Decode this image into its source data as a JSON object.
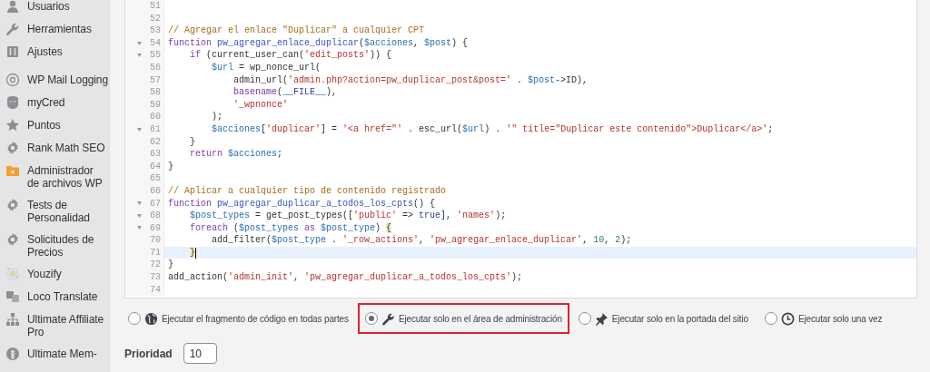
{
  "sidebar": {
    "groups": [
      {
        "items": [
          {
            "label": "Usuarios"
          },
          {
            "label": "Herramientas"
          },
          {
            "label": "Ajustes"
          }
        ]
      },
      {
        "items": [
          {
            "label": "WP Mail Logging"
          },
          {
            "label": "myCred"
          },
          {
            "label": "Puntos"
          },
          {
            "label": "Rank Math SEO"
          },
          {
            "label": "Administrador de archivos WP"
          },
          {
            "label": "Tests de Personalidad"
          },
          {
            "label": "Solicitudes de Precios"
          },
          {
            "label": "Youzify"
          },
          {
            "label": "Loco Translate"
          },
          {
            "label": "Ultimate Affiliate Pro"
          },
          {
            "label": "Ultimate Mem-"
          }
        ]
      }
    ]
  },
  "editor": {
    "lines": [
      {
        "number": "51",
        "foldable": false,
        "active": false
      },
      {
        "number": "52",
        "foldable": false,
        "active": false
      },
      {
        "number": "53",
        "foldable": false,
        "active": false,
        "tokens": [
          {
            "text": "// Agregar el enlace \"Duplicar\" a cualquier CPT",
            "kind": "comment"
          }
        ]
      },
      {
        "number": "54",
        "foldable": true,
        "active": false,
        "tokens": [
          {
            "text": "function ",
            "kind": "keyword"
          },
          {
            "text": "pw_agregar_enlace_duplicar",
            "kind": "def"
          },
          {
            "text": "(",
            "kind": "plain"
          },
          {
            "text": "$acciones",
            "kind": "variable"
          },
          {
            "text": ", ",
            "kind": "plain"
          },
          {
            "text": "$post",
            "kind": "variable"
          },
          {
            "text": ") {",
            "kind": "plain"
          }
        ]
      },
      {
        "number": "55",
        "foldable": true,
        "active": false,
        "tokens": [
          {
            "text": "    if",
            "kind": "keyword"
          },
          {
            "text": " (current_user_can(",
            "kind": "plain"
          },
          {
            "text": "'edit_posts'",
            "kind": "string"
          },
          {
            "text": ")) {",
            "kind": "plain"
          }
        ]
      },
      {
        "number": "56",
        "foldable": false,
        "active": false,
        "tokens": [
          {
            "text": "        $url",
            "kind": "variable"
          },
          {
            "text": " = wp_nonce_url(",
            "kind": "plain"
          }
        ]
      },
      {
        "number": "57",
        "foldable": false,
        "active": false,
        "tokens": [
          {
            "text": "            admin_url(",
            "kind": "plain"
          },
          {
            "text": "'admin.php?action=pw_duplicar_post&post='",
            "kind": "string"
          },
          {
            "text": " . ",
            "kind": "plain"
          },
          {
            "text": "$post",
            "kind": "variable"
          },
          {
            "text": "->ID),",
            "kind": "plain"
          }
        ]
      },
      {
        "number": "58",
        "foldable": false,
        "active": false,
        "tokens": [
          {
            "text": "            basename",
            "kind": "builtin"
          },
          {
            "text": "(",
            "kind": "plain"
          },
          {
            "text": "__FILE__",
            "kind": "atom"
          },
          {
            "text": "),",
            "kind": "plain"
          }
        ]
      },
      {
        "number": "59",
        "foldable": false,
        "active": false,
        "tokens": [
          {
            "text": "            '_wpnonce'",
            "kind": "string"
          }
        ]
      },
      {
        "number": "60",
        "foldable": false,
        "active": false,
        "tokens": [
          {
            "text": "        );",
            "kind": "plain"
          }
        ]
      },
      {
        "number": "61",
        "foldable": true,
        "active": false,
        "tokens": [
          {
            "text": "        $acciones",
            "kind": "variable"
          },
          {
            "text": "[",
            "kind": "plain"
          },
          {
            "text": "'duplicar'",
            "kind": "string"
          },
          {
            "text": "] = ",
            "kind": "plain"
          },
          {
            "text": "'<a href=\"'",
            "kind": "string"
          },
          {
            "text": " . esc_url(",
            "kind": "plain"
          },
          {
            "text": "$url",
            "kind": "variable"
          },
          {
            "text": ") . ",
            "kind": "plain"
          },
          {
            "text": "'\" title=\"Duplicar este contenido\">Duplicar</a>'",
            "kind": "string"
          },
          {
            "text": ";",
            "kind": "plain"
          }
        ]
      },
      {
        "number": "62",
        "foldable": false,
        "active": false,
        "tokens": [
          {
            "text": "    }",
            "kind": "plain"
          }
        ]
      },
      {
        "number": "63",
        "foldable": false,
        "active": false,
        "tokens": [
          {
            "text": "    return ",
            "kind": "keyword"
          },
          {
            "text": "$acciones",
            "kind": "variable"
          },
          {
            "text": ";",
            "kind": "plain"
          }
        ]
      },
      {
        "number": "64",
        "foldable": false,
        "active": false,
        "tokens": [
          {
            "text": "}",
            "kind": "plain"
          }
        ]
      },
      {
        "number": "65",
        "foldable": false,
        "active": false
      },
      {
        "number": "66",
        "foldable": false,
        "active": false,
        "tokens": [
          {
            "text": "// Aplicar a cualquier tipo de contenido registrado",
            "kind": "comment"
          }
        ]
      },
      {
        "number": "67",
        "foldable": true,
        "active": false,
        "tokens": [
          {
            "text": "function ",
            "kind": "keyword"
          },
          {
            "text": "pw_agregar_duplicar_a_todos_los_cpts",
            "kind": "def"
          },
          {
            "text": "() {",
            "kind": "plain"
          }
        ]
      },
      {
        "number": "68",
        "foldable": true,
        "active": false,
        "tokens": [
          {
            "text": "    $post_types",
            "kind": "variable"
          },
          {
            "text": " = get_post_types([",
            "kind": "plain"
          },
          {
            "text": "'public'",
            "kind": "string"
          },
          {
            "text": " => ",
            "kind": "plain"
          },
          {
            "text": "true",
            "kind": "atom"
          },
          {
            "text": "], ",
            "kind": "plain"
          },
          {
            "text": "'names'",
            "kind": "string"
          },
          {
            "text": ");",
            "kind": "plain"
          }
        ]
      },
      {
        "number": "69",
        "foldable": true,
        "active": false,
        "tokens": [
          {
            "text": "    foreach",
            "kind": "keyword"
          },
          {
            "text": " (",
            "kind": "plain"
          },
          {
            "text": "$post_types",
            "kind": "variable"
          },
          {
            "text": " as ",
            "kind": "keyword"
          },
          {
            "text": "$post_type",
            "kind": "variable"
          },
          {
            "text": ") ",
            "kind": "plain"
          },
          {
            "text": "{",
            "kind": "bracket"
          }
        ]
      },
      {
        "number": "70",
        "foldable": false,
        "active": false,
        "tokens": [
          {
            "text": "        add_filter(",
            "kind": "plain"
          },
          {
            "text": "$post_type",
            "kind": "variable"
          },
          {
            "text": " . ",
            "kind": "plain"
          },
          {
            "text": "'_row_actions'",
            "kind": "string"
          },
          {
            "text": ", ",
            "kind": "plain"
          },
          {
            "text": "'pw_agregar_enlace_duplicar'",
            "kind": "string"
          },
          {
            "text": ", ",
            "kind": "plain"
          },
          {
            "text": "10",
            "kind": "number"
          },
          {
            "text": ", ",
            "kind": "plain"
          },
          {
            "text": "2",
            "kind": "number"
          },
          {
            "text": ");",
            "kind": "plain"
          }
        ]
      },
      {
        "number": "71",
        "foldable": false,
        "active": true,
        "tokens": [
          {
            "text": "    }",
            "kind": "bracket"
          }
        ]
      },
      {
        "number": "72",
        "foldable": false,
        "active": false,
        "tokens": [
          {
            "text": "}",
            "kind": "plain"
          }
        ]
      },
      {
        "number": "73",
        "foldable": false,
        "active": false,
        "tokens": [
          {
            "text": "add_action(",
            "kind": "plain"
          },
          {
            "text": "'admin_init'",
            "kind": "string"
          },
          {
            "text": ", ",
            "kind": "plain"
          },
          {
            "text": "'pw_agregar_duplicar_a_todos_los_cpts'",
            "kind": "string"
          },
          {
            "text": ");",
            "kind": "plain"
          }
        ]
      },
      {
        "number": "74",
        "foldable": false,
        "active": false
      }
    ]
  },
  "scope_options": [
    {
      "label": "Ejecutar el fragmento de código en todas partes",
      "selected": false,
      "highlighted": false
    },
    {
      "label": "Ejecutar solo en el área de administración",
      "selected": true,
      "highlighted": true
    },
    {
      "label": "Ejecutar solo en la portada del sitio",
      "selected": false,
      "highlighted": false
    },
    {
      "label": "Ejecutar solo una vez",
      "selected": false,
      "highlighted": false
    }
  ],
  "priority": {
    "label": "Prioridad",
    "value": "10"
  }
}
